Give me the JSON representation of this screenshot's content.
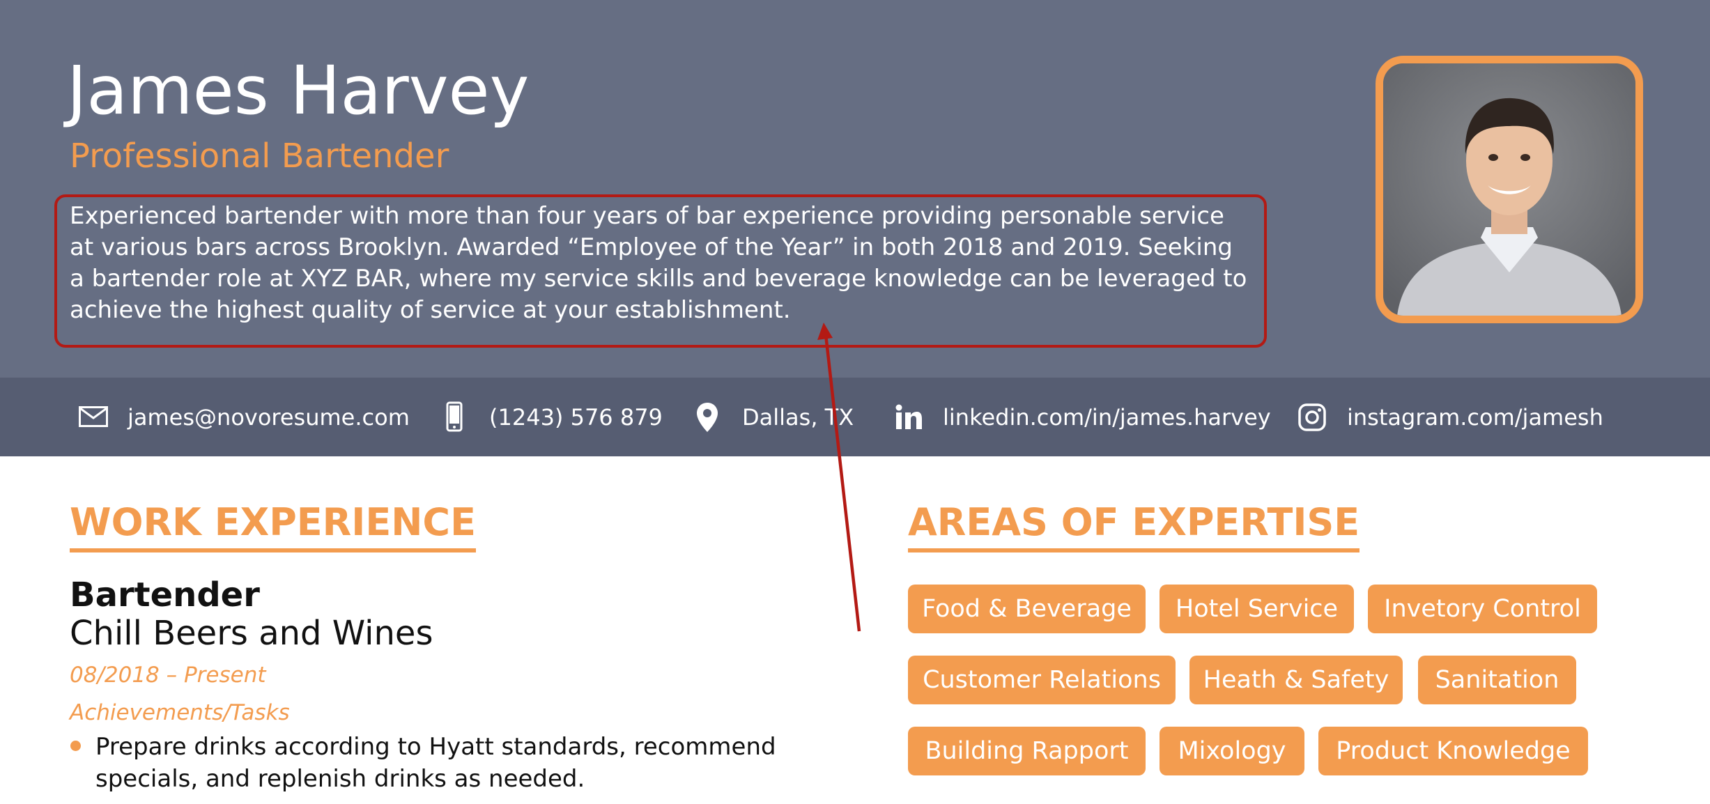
{
  "header": {
    "name": "James Harvey",
    "title": "Professional Bartender",
    "summary": "Experienced bartender with more than four years of bar experience providing personable service at various bars across Brooklyn. Awarded “Employee of the Year” in both 2018 and 2019. Seeking a bartender role at XYZ BAR, where my service skills and beverage knowledge can be leveraged to achieve the highest quality of service at your establishment."
  },
  "contact": {
    "email": "james@novoresume.com",
    "phone": "(1243) 576 879",
    "location": "Dallas, TX",
    "linkedin": "linkedin.com/in/james.harvey",
    "instagram": "instagram.com/jamesh"
  },
  "work_experience": {
    "heading": "WORK EXPERIENCE",
    "jobs": [
      {
        "title": "Bartender",
        "company": "Chill Beers and Wines",
        "dates": "08/2018 – Present",
        "tasks_label": "Achievements/Tasks",
        "tasks": [
          "Prepare drinks according to Hyatt standards, recommend specials, and replenish drinks as needed."
        ]
      }
    ]
  },
  "expertise": {
    "heading": "AREAS OF EXPERTISE",
    "skills": [
      "Food & Beverage",
      "Hotel Service",
      "Invetory Control",
      "Customer Relations",
      "Heath & Safety",
      "Sanitation",
      "Building Rapport",
      "Mixology",
      "Product Knowledge"
    ]
  },
  "icons": [
    "envelope-icon",
    "phone-icon",
    "location-pin-icon",
    "linkedin-icon",
    "instagram-icon"
  ],
  "colors": {
    "header_bg": "#666e83",
    "contact_bar_bg": "#565d72",
    "accent": "#f39c4f",
    "annotation_red": "#b31a14"
  }
}
